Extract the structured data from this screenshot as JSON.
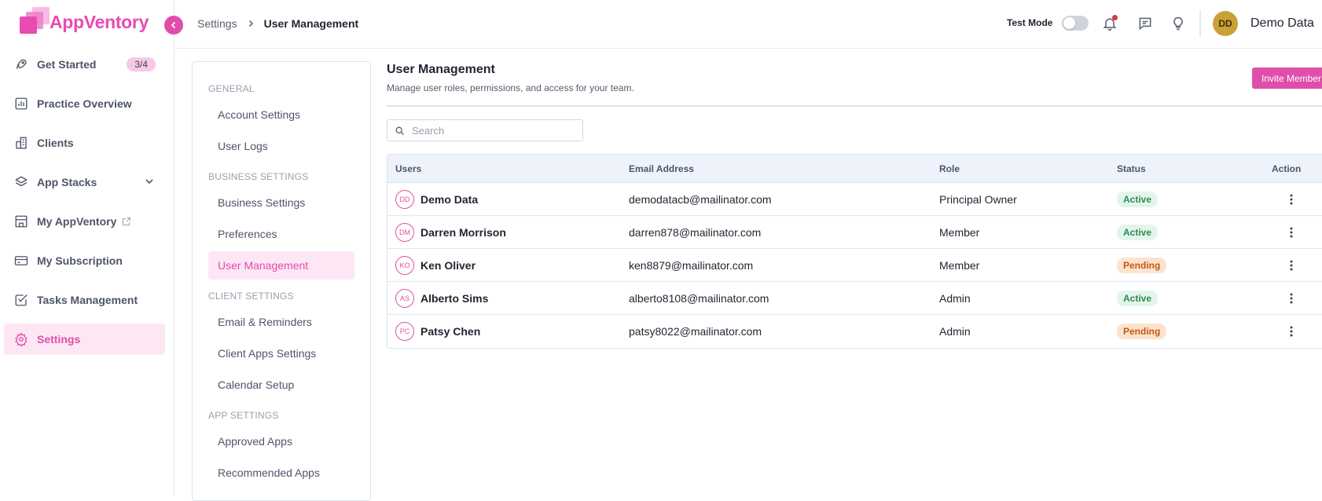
{
  "app": {
    "name": "AppVentory"
  },
  "sidebar": {
    "items": [
      {
        "label": "Get Started",
        "icon": "rocket-icon",
        "badge": "3/4"
      },
      {
        "label": "Practice Overview",
        "icon": "bar-chart-icon"
      },
      {
        "label": "Clients",
        "icon": "building-icon"
      },
      {
        "label": "App Stacks",
        "icon": "layers-icon"
      },
      {
        "label": "My AppVentory",
        "icon": "storefront-icon"
      },
      {
        "label": "My Subscription",
        "icon": "credit-card-icon"
      },
      {
        "label": "Tasks Management",
        "icon": "checkbox-icon"
      },
      {
        "label": "Settings",
        "icon": "gear-icon",
        "active": true
      }
    ]
  },
  "breadcrumb": {
    "parent": "Settings",
    "current": "User Management"
  },
  "header": {
    "test_mode_label": "Test Mode",
    "test_mode_on": false,
    "user_initials": "DD",
    "user_name": "Demo Data"
  },
  "settings_nav": {
    "sections": [
      {
        "title": "GENERAL",
        "items": [
          "Account Settings",
          "User Logs"
        ]
      },
      {
        "title": "BUSINESS SETTINGS",
        "items": [
          "Business Settings",
          "Preferences",
          "User Management"
        ]
      },
      {
        "title": "CLIENT SETTINGS",
        "items": [
          "Email & Reminders",
          "Client Apps Settings",
          "Calendar Setup"
        ]
      },
      {
        "title": "APP SETTINGS",
        "items": [
          "Approved Apps",
          "Recommended Apps"
        ]
      }
    ],
    "active": "User Management"
  },
  "main": {
    "title": "User Management",
    "subtitle": "Manage user roles, permissions, and access for your team.",
    "invite_label": "Invite Member",
    "search_placeholder": "Search"
  },
  "table": {
    "columns": [
      "Users",
      "Email Address",
      "Role",
      "Status",
      "Action"
    ],
    "rows": [
      {
        "initials": "DD",
        "name": "Demo Data",
        "email": "demodatacb@mailinator.com",
        "role": "Principal Owner",
        "status": "Active"
      },
      {
        "initials": "DM",
        "name": "Darren Morrison",
        "email": "darren878@mailinator.com",
        "role": "Member",
        "status": "Active"
      },
      {
        "initials": "KO",
        "name": "Ken Oliver",
        "email": "ken8879@mailinator.com",
        "role": "Member",
        "status": "Pending"
      },
      {
        "initials": "AS",
        "name": "Alberto Sims",
        "email": "alberto8108@mailinator.com",
        "role": "Admin",
        "status": "Active"
      },
      {
        "initials": "PC",
        "name": "Patsy Chen",
        "email": "patsy8022@mailinator.com",
        "role": "Admin",
        "status": "Pending"
      }
    ]
  },
  "colors": {
    "brand": "#e04ea9",
    "active_status": "#2e8b57",
    "pending_status": "#c25a10"
  }
}
